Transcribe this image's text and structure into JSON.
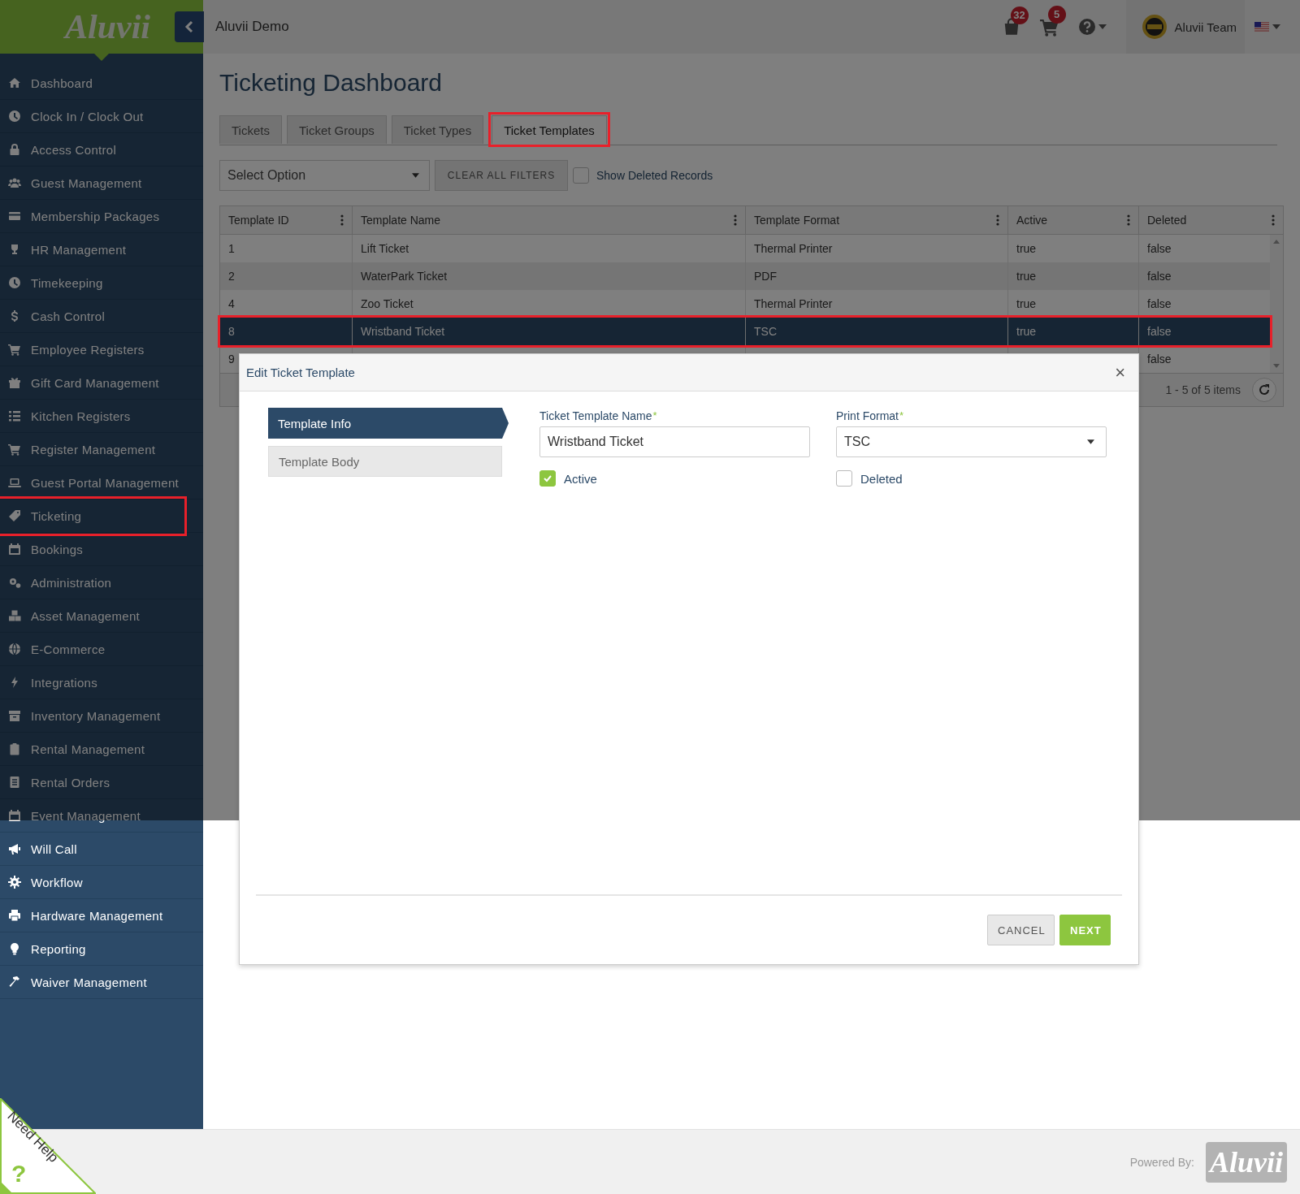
{
  "sidebar": {
    "logo": "Aluvii",
    "items": [
      {
        "label": "Dashboard",
        "highlighted": false
      },
      {
        "label": "Clock In / Clock Out",
        "highlighted": false
      },
      {
        "label": "Access Control",
        "highlighted": false
      },
      {
        "label": "Guest Management",
        "highlighted": false
      },
      {
        "label": "Membership Packages",
        "highlighted": false
      },
      {
        "label": "HR Management",
        "highlighted": false
      },
      {
        "label": "Timekeeping",
        "highlighted": false
      },
      {
        "label": "Cash Control",
        "highlighted": false
      },
      {
        "label": "Employee Registers",
        "highlighted": false
      },
      {
        "label": "Gift Card Management",
        "highlighted": false
      },
      {
        "label": "Kitchen Registers",
        "highlighted": false
      },
      {
        "label": "Register Management",
        "highlighted": false
      },
      {
        "label": "Guest Portal Management",
        "highlighted": false
      },
      {
        "label": "Ticketing",
        "highlighted": true
      },
      {
        "label": "Bookings",
        "highlighted": false
      },
      {
        "label": "Administration",
        "highlighted": false
      },
      {
        "label": "Asset Management",
        "highlighted": false
      },
      {
        "label": "E-Commerce",
        "highlighted": false
      },
      {
        "label": "Integrations",
        "highlighted": false
      },
      {
        "label": "Inventory Management",
        "highlighted": false
      },
      {
        "label": "Rental Management",
        "highlighted": false
      },
      {
        "label": "Rental Orders",
        "highlighted": false
      },
      {
        "label": "Event Management",
        "highlighted": false
      },
      {
        "label": "Will Call",
        "highlighted": false
      },
      {
        "label": "Workflow",
        "highlighted": false
      },
      {
        "label": "Hardware Management",
        "highlighted": false
      },
      {
        "label": "Reporting",
        "highlighted": false
      },
      {
        "label": "Waiver Management",
        "highlighted": false
      }
    ]
  },
  "topbar": {
    "title": "Aluvii Demo",
    "bag_count": "32",
    "cart_count": "5",
    "user": "Aluvii Team"
  },
  "page_title": "Ticketing Dashboard",
  "tabs": [
    {
      "label": "Tickets",
      "selected": false,
      "highlighted": false
    },
    {
      "label": "Ticket Groups",
      "selected": false,
      "highlighted": false
    },
    {
      "label": "Ticket Types",
      "selected": false,
      "highlighted": false
    },
    {
      "label": "Ticket Templates",
      "selected": true,
      "highlighted": true
    }
  ],
  "filters": {
    "select_placeholder": "Select Option",
    "clear_button": "CLEAR ALL FILTERS",
    "show_deleted": {
      "label": "Show Deleted Records",
      "checked": false
    }
  },
  "table": {
    "columns": [
      "Template ID",
      "Template Name",
      "Template Format",
      "Active",
      "Deleted"
    ],
    "rows": [
      {
        "cells": [
          "1",
          "Lift Ticket",
          "Thermal Printer",
          "true",
          "false"
        ],
        "selected": false,
        "highlighted": false
      },
      {
        "cells": [
          "2",
          "WaterPark Ticket",
          "PDF",
          "true",
          "false"
        ],
        "selected": false,
        "highlighted": false
      },
      {
        "cells": [
          "4",
          "Zoo Ticket",
          "Thermal Printer",
          "true",
          "false"
        ],
        "selected": false,
        "highlighted": false
      },
      {
        "cells": [
          "8",
          "Wristband Ticket",
          "TSC",
          "true",
          "false"
        ],
        "selected": true,
        "highlighted": true
      },
      {
        "cells": [
          "9",
          null,
          null,
          null,
          "false"
        ],
        "selected": false,
        "highlighted": false
      }
    ],
    "pager": "1 - 5 of 5 items"
  },
  "modal": {
    "title": "Edit Ticket Template",
    "close": "×",
    "nav": [
      {
        "label": "Template Info",
        "selected": true
      },
      {
        "label": "Template Body",
        "selected": false
      }
    ],
    "fields": [
      {
        "kind": "text",
        "label": "Ticket Template Name",
        "required_mark": "*",
        "value": "Wristband Ticket"
      },
      {
        "kind": "select",
        "label": "Print Format",
        "required_mark": "*",
        "value": "TSC"
      },
      {
        "kind": "checkbox",
        "label": "Active",
        "checked": true
      },
      {
        "kind": "checkbox",
        "label": "Deleted",
        "checked": false
      }
    ],
    "buttons": [
      {
        "label": "CANCEL",
        "kind": "secondary"
      },
      {
        "label": "NEXT",
        "kind": "primary"
      }
    ]
  },
  "footer": {
    "powered_by": "Powered By:",
    "logo": "Aluvii"
  },
  "help_corner": {
    "label": "Need Help",
    "mark": "?"
  }
}
